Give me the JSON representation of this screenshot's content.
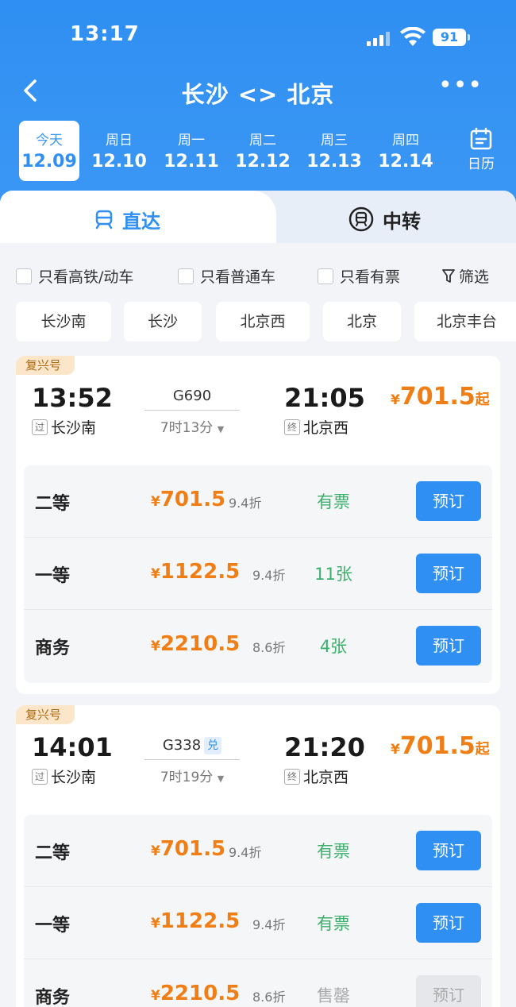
{
  "status_bar": {
    "time": "13:17",
    "battery": "91"
  },
  "nav": {
    "title": "长沙 <> 北京"
  },
  "dates": [
    {
      "weekday": "今天",
      "date": "12.09",
      "active": true
    },
    {
      "weekday": "周日",
      "date": "12.10"
    },
    {
      "weekday": "周一",
      "date": "12.11"
    },
    {
      "weekday": "周二",
      "date": "12.12"
    },
    {
      "weekday": "周三",
      "date": "12.13"
    },
    {
      "weekday": "周四",
      "date": "12.14"
    }
  ],
  "calendar_label": "日历",
  "tabs": {
    "direct": "直达",
    "transfer": "中转"
  },
  "filters": {
    "high_speed": "只看高铁/动车",
    "normal": "只看普通车",
    "available": "只看有票",
    "filter_btn": "筛选"
  },
  "stations": [
    "长沙南",
    "长沙",
    "北京西",
    "北京",
    "北京丰台"
  ],
  "trains": [
    {
      "badge": "复兴号",
      "dep_time": "13:52",
      "arr_time": "21:05",
      "dep_tag": "过",
      "dep_station": "长沙南",
      "arr_tag": "终",
      "arr_station": "北京西",
      "train_no": "G690",
      "duration": "7时13分",
      "price_yen": "¥",
      "min_price": "701.5",
      "price_suffix": "起",
      "seats": [
        {
          "name": "二等",
          "yen": "¥",
          "price": "701.5",
          "discount": "9.4折",
          "avail": "有票",
          "book": "预订"
        },
        {
          "name": "一等",
          "yen": "¥",
          "price": "1122.5",
          "discount": "9.4折",
          "avail": "11张",
          "book": "预订"
        },
        {
          "name": "商务",
          "yen": "¥",
          "price": "2210.5",
          "discount": "8.6折",
          "avail": "4张",
          "book": "预订"
        }
      ]
    },
    {
      "badge": "复兴号",
      "dep_time": "14:01",
      "arr_time": "21:20",
      "dep_tag": "过",
      "dep_station": "长沙南",
      "arr_tag": "终",
      "arr_station": "北京西",
      "train_no": "G338",
      "exchange_tag": "兑",
      "duration": "7时19分",
      "price_yen": "¥",
      "min_price": "701.5",
      "price_suffix": "起",
      "seats": [
        {
          "name": "二等",
          "yen": "¥",
          "price": "701.5",
          "discount": "9.4折",
          "avail": "有票",
          "book": "预订"
        },
        {
          "name": "一等",
          "yen": "¥",
          "price": "1122.5",
          "discount": "9.4折",
          "avail": "有票",
          "book": "预订"
        },
        {
          "name": "商务",
          "yen": "¥",
          "price": "2210.5",
          "discount": "8.6折",
          "avail": "售罄",
          "book": "预订"
        }
      ]
    }
  ],
  "colors": {
    "primary": "#2f8ff2",
    "price": "#f07e14",
    "available": "#3bb06b",
    "badge_bg": "#fbe6c9"
  }
}
